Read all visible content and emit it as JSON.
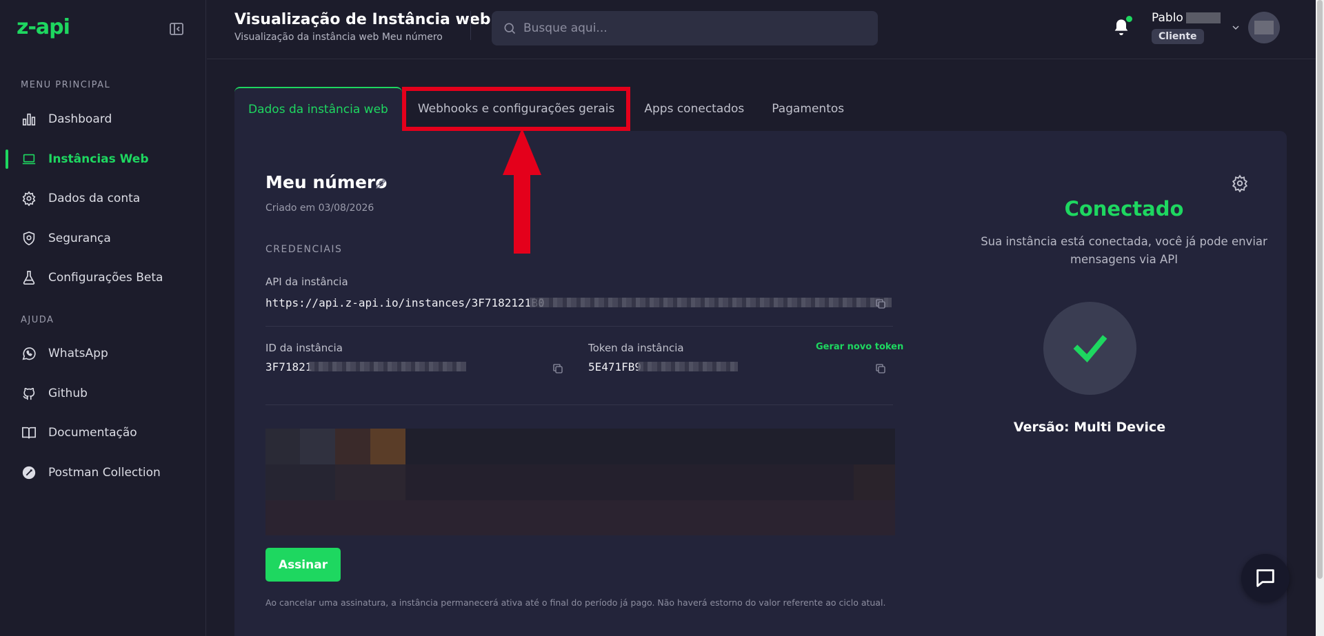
{
  "brand": {
    "logo_text": "z-api",
    "accent": "#1ed760"
  },
  "sidebar": {
    "main_menu_label": "MENU PRINCIPAL",
    "help_label": "AJUDA",
    "main_items": [
      {
        "label": "Dashboard",
        "icon": "bar-chart-icon"
      },
      {
        "label": "Instâncias Web",
        "icon": "laptop-icon",
        "active": true
      },
      {
        "label": "Dados da conta",
        "icon": "gear-icon"
      },
      {
        "label": "Segurança",
        "icon": "shield-icon"
      },
      {
        "label": "Configurações Beta",
        "icon": "flask-icon"
      }
    ],
    "help_items": [
      {
        "label": "WhatsApp",
        "icon": "whatsapp-icon"
      },
      {
        "label": "Github",
        "icon": "github-icon"
      },
      {
        "label": "Documentação",
        "icon": "book-icon"
      },
      {
        "label": "Postman Collection",
        "icon": "postman-icon"
      }
    ]
  },
  "header": {
    "title": "Visualização de Instância web",
    "subtitle": "Visualização da instância web Meu número",
    "search_placeholder": "Busque aqui...",
    "user_name": "Pablo",
    "user_role": "Cliente"
  },
  "tabs": [
    {
      "label": "Dados da instância web",
      "active": true
    },
    {
      "label": "Webhooks e configurações gerais",
      "highlighted": true
    },
    {
      "label": "Apps conectados"
    },
    {
      "label": "Pagamentos"
    }
  ],
  "instance": {
    "name": "Meu número",
    "created": "Criado em 03/08/2026",
    "credentials_label": "CREDENCIAIS",
    "api_label": "API da instância",
    "api_value": "https://api.z-api.io/instances/3F7182121B0",
    "id_label": "ID da instância",
    "id_value": "3F71821",
    "token_label": "Token da instância",
    "token_value": "5E471FB9",
    "new_token_label": "Gerar novo token",
    "sign_button": "Assinar",
    "disclaimer": "Ao cancelar uma assinatura, a instância permanecerá ativa até o final do período já pago. Não haverá estorno do valor referente ao ciclo atual."
  },
  "status": {
    "title": "Conectado",
    "description": "Sua instância está conectada, você já pode enviar mensagens via API",
    "version": "Versão: Multi Device"
  },
  "colors": {
    "highlight_box": "#e4001b",
    "arrow": "#e4001b"
  }
}
